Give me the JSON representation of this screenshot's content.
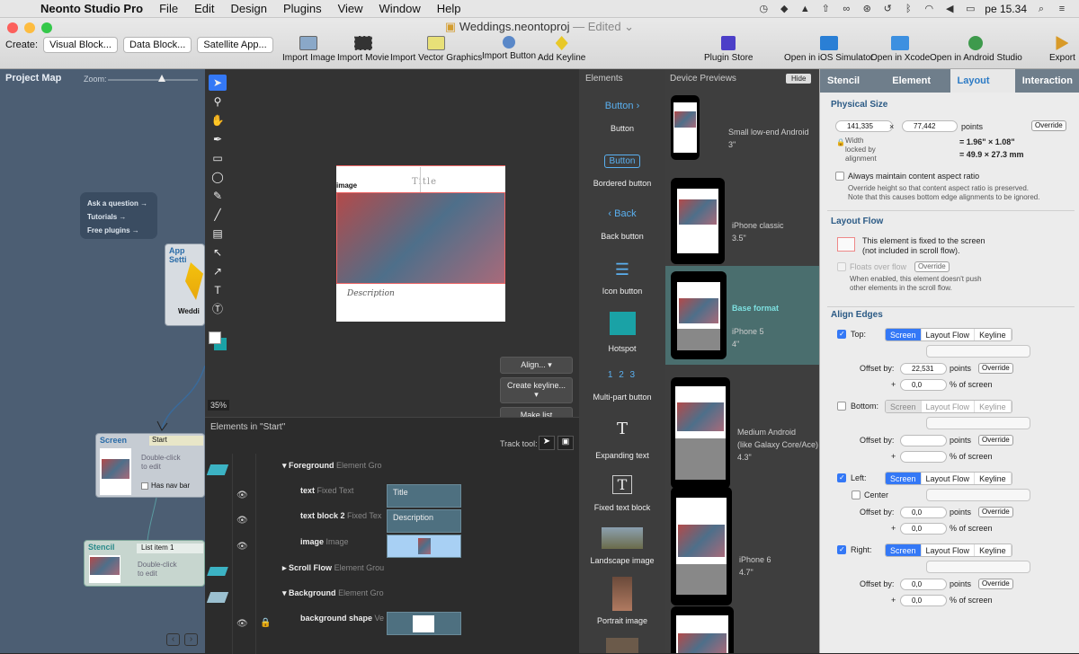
{
  "menubar": {
    "app_name": "Neonto Studio Pro",
    "menus": [
      "File",
      "Edit",
      "Design",
      "Plugins",
      "View",
      "Window",
      "Help"
    ],
    "clock": "pe 15.34"
  },
  "window": {
    "title": "Weddings.neontoproj",
    "edited": "— Edited ⌄"
  },
  "createbar": {
    "label": "Create:",
    "buttons": [
      "Visual Block...",
      "Data Block...",
      "Satellite App..."
    ]
  },
  "toolbar": {
    "import_image": "Import Image",
    "import_movie": "Import Movie",
    "import_vector": "Import Vector Graphics",
    "import_button": "Import Button",
    "add_keyline": "Add Keyline",
    "plugin_store": "Plugin Store",
    "open_ios": "Open in iOS Simulator",
    "open_xcode": "Open in Xcode",
    "open_android": "Open in Android Studio",
    "export": "Export"
  },
  "project_map": {
    "title": "Project Map",
    "zoom_label": "Zoom:",
    "help_links": [
      "Ask a question →",
      "Tutorials →",
      "Free plugins →"
    ],
    "app_card_title": "App Setti",
    "app_card_sub": "Weddi",
    "screen_card": {
      "type": "Screen",
      "name": "Start",
      "hint": "Double-click\nto edit",
      "navbar": "Has nav bar"
    },
    "stencil_card": {
      "type": "Stencil",
      "name": "List item 1",
      "hint": "Double-click\nto edit"
    }
  },
  "canvas": {
    "zoom": "35%",
    "phone_image_label": "image",
    "phone_title": "Title",
    "phone_description": "Description",
    "align_btn": "Align...",
    "keyline_btn": "Create keyline...",
    "makelist_btn": "Make list"
  },
  "element_tree": {
    "title": "Elements in \"Start\"",
    "track_tool": "Track tool:",
    "rows": [
      {
        "name": "Foreground",
        "type": "Element Gro"
      },
      {
        "name": "text",
        "type": "Fixed Text",
        "bar": "Title"
      },
      {
        "name": "text block 2",
        "type": "Fixed Tex",
        "bar": "Description"
      },
      {
        "name": "image",
        "type": "Image"
      },
      {
        "name": "Scroll Flow",
        "type": "Element Grou"
      },
      {
        "name": "Background",
        "type": "Element Gro"
      },
      {
        "name": "background shape",
        "type": "Ve"
      }
    ]
  },
  "elements_panel": {
    "title": "Elements",
    "items": [
      {
        "preview": "Button ›",
        "label": "Button"
      },
      {
        "preview": "Button",
        "label": "Bordered button"
      },
      {
        "preview": "‹ Back",
        "label": "Back button"
      },
      {
        "preview": "☰",
        "label": "Icon button"
      },
      {
        "preview": "",
        "label": "Hotspot"
      },
      {
        "preview": "1 2 3",
        "label": "Multi-part button"
      },
      {
        "preview": "T",
        "label": "Expanding text"
      },
      {
        "preview": "T",
        "label": "Fixed text block"
      },
      {
        "preview": "",
        "label": "Landscape image"
      },
      {
        "preview": "",
        "label": "Portrait image"
      }
    ]
  },
  "previews": {
    "title": "Device Previews",
    "hide": "Hide",
    "devices": [
      {
        "name": "Small low-end Android",
        "size": "3\""
      },
      {
        "name": "iPhone classic",
        "size": "3.5\""
      },
      {
        "name": "Base format",
        "size": "iPhone 5",
        "size2": "4\""
      },
      {
        "name": "Medium Android",
        "name2": "(like Galaxy Core/Ace)",
        "size": "4.3\""
      },
      {
        "name": "iPhone 6",
        "size": "4.7\""
      }
    ]
  },
  "inspector": {
    "tabs": [
      "Stencil",
      "Element",
      "Layout",
      "Interaction"
    ],
    "physical_size": {
      "title": "Physical Size",
      "width": "141,335",
      "height": "77,442",
      "x": "×",
      "unit": "points",
      "override": "Override",
      "locked": "Width\nlocked by\nalignment",
      "inches": "= 1.96\" × 1.08\"",
      "mm": "= 49.9 × 27.3 mm",
      "aspect": "Always maintain content aspect ratio",
      "aspect_note": "Override height so that content aspect ratio is preserved.\nNote that this causes bottom edge alignments to be ignored."
    },
    "layout_flow": {
      "title": "Layout Flow",
      "fixed_note": "This element is fixed to the screen\n(not included in scroll flow).",
      "floats": "Floats over flow",
      "override": "Override",
      "floats_note": "When enabled, this element doesn't push\nother elements in the scroll flow."
    },
    "align_edges": {
      "title": "Align Edges",
      "seg": [
        "Screen",
        "Layout Flow",
        "Keyline"
      ],
      "top": "Top:",
      "bottom": "Bottom:",
      "left": "Left:",
      "right": "Right:",
      "center": "Center",
      "offset_by": "Offset by:",
      "points": "points",
      "pct": "% of screen",
      "plus": "+",
      "override": "Override",
      "top_offset": "22,531",
      "zero": "0,0"
    }
  },
  "colors": {
    "accent": "#3478f6",
    "map_bg": "#4c5e73",
    "active_tab": "#2d7bc5",
    "base_format_bg": "#4a6e6e"
  }
}
